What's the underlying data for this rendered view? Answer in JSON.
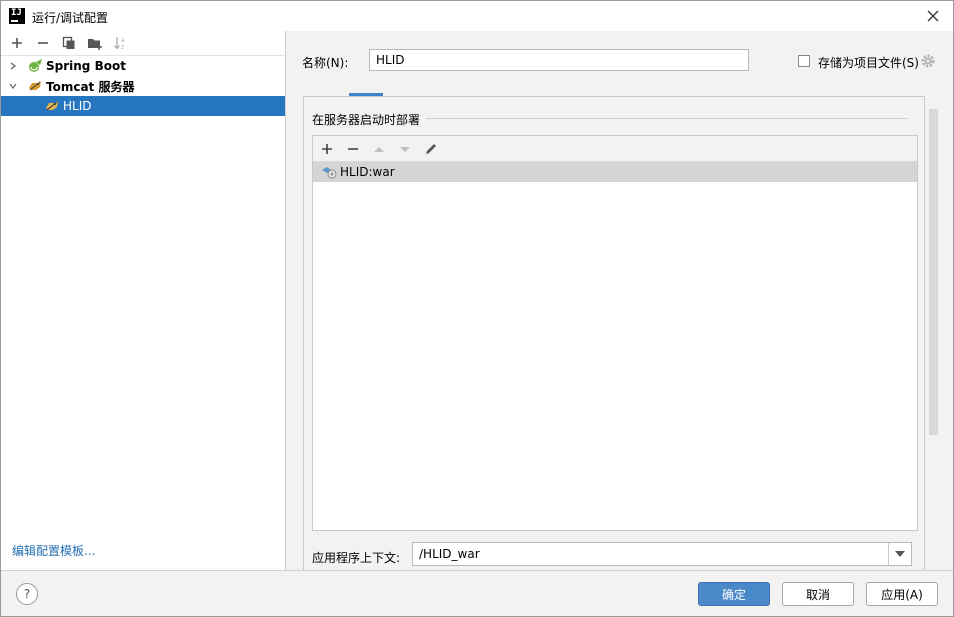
{
  "window": {
    "title": "运行/调试配置",
    "app_icon_text": "IJ"
  },
  "left": {
    "toolbar": [
      "add-icon",
      "remove-icon",
      "copy-icon",
      "new-folder-icon",
      "sort-icon"
    ],
    "tree": [
      {
        "label": "Spring Boot",
        "expanded": false
      },
      {
        "label": "Tomcat 服务器",
        "expanded": true
      },
      {
        "label": "HLID",
        "selected": true
      }
    ],
    "edit_templates": "编辑配置模板..."
  },
  "right": {
    "name_label": "名称(N):",
    "name_value": "HLID",
    "store_as_file": {
      "label": "存储为项目文件(S)",
      "checked": false
    },
    "section_title": "在服务器启动时部署",
    "deploy_toolbar": [
      "add-icon",
      "remove-icon",
      "move-up-icon",
      "move-down-icon",
      "edit-icon"
    ],
    "deploy_items": [
      {
        "label": "HLID:war"
      }
    ],
    "context_label": "应用程序上下文:",
    "context_value": "/HLID_war"
  },
  "footer": {
    "help": "?",
    "ok": "确定",
    "cancel": "取消",
    "apply": "应用(A)"
  },
  "colors": {
    "selection": "#2675bf",
    "link": "#2470b3",
    "primary_button": "#4a89c8",
    "tab_underline": "#4083c9"
  }
}
